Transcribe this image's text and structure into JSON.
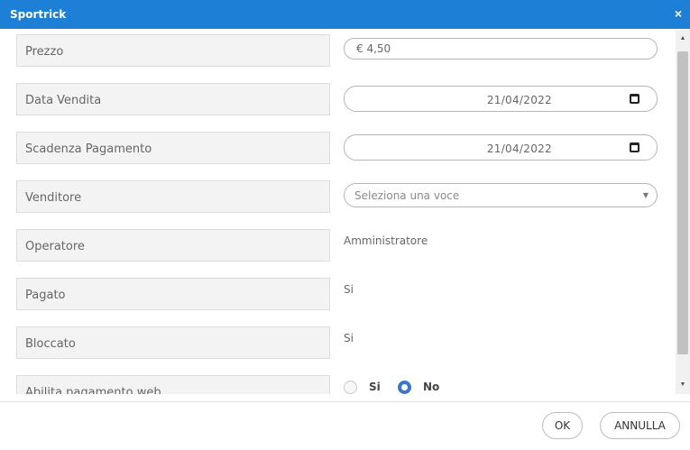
{
  "window": {
    "title": "Sportrick",
    "close_glyph": "×"
  },
  "form": {
    "prezzo": {
      "label": "Prezzo",
      "value": "€ 4,50"
    },
    "data_vendita": {
      "label": "Data Vendita",
      "value": "21/04/2022"
    },
    "scadenza_pagamento": {
      "label": "Scadenza Pagamento",
      "value": "21/04/2022"
    },
    "venditore": {
      "label": "Venditore",
      "placeholder": "Seleziona una voce"
    },
    "operatore": {
      "label": "Operatore",
      "value": "Amministratore"
    },
    "pagato": {
      "label": "Pagato",
      "value": "Si"
    },
    "bloccato": {
      "label": "Bloccato",
      "value": "Si"
    },
    "abilita_pagamento_web": {
      "label": "Abilita pagamento web",
      "options": [
        {
          "label": "Si",
          "checked": false
        },
        {
          "label": "No",
          "checked": true
        }
      ]
    }
  },
  "footer": {
    "ok_label": "OK",
    "cancel_label": "ANNULLA"
  },
  "icons": {
    "calendar": "calendar-icon",
    "dropdown": "chevron-down-icon",
    "close": "close-icon"
  },
  "colors": {
    "titlebar": "#1e7fd6",
    "radio_checked": "#3a78c7"
  }
}
